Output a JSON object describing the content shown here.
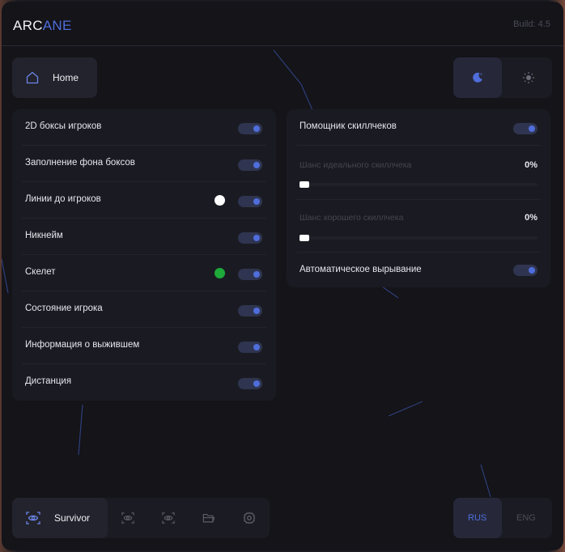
{
  "header": {
    "logo_main": "ARC",
    "logo_accent": "ANE",
    "build": "Build: 4.5"
  },
  "home": {
    "label": "Home"
  },
  "left_panel": {
    "rows": [
      {
        "label": "2D боксы игроков",
        "enabled": true
      },
      {
        "label": "Заполнение фона боксов",
        "enabled": true
      },
      {
        "label": "Линии до игроков",
        "enabled": true,
        "color": "#ffffff"
      },
      {
        "label": "Никнейм",
        "enabled": true
      },
      {
        "label": "Скелет",
        "enabled": true,
        "color": "#1eaa3a"
      },
      {
        "label": "Состояние игрока",
        "enabled": true
      },
      {
        "label": "Информация о выжившем",
        "enabled": true
      },
      {
        "label": "Дистанция",
        "enabled": true
      }
    ]
  },
  "right_panel": {
    "helper_label": "Помощник скиллчеков",
    "perfect_label": "Шанс идеального скиллчека",
    "perfect_value": "0%",
    "good_label": "Шанс хорошего скиллчека",
    "good_value": "0%",
    "auto_label": "Автоматическое вырывание"
  },
  "bottom_nav": {
    "active_label": "Survivor"
  },
  "language": {
    "rus": "RUS",
    "eng": "ENG"
  },
  "colors": {
    "accent": "#4f6ddb",
    "toggle_bg": "#2f3550"
  }
}
